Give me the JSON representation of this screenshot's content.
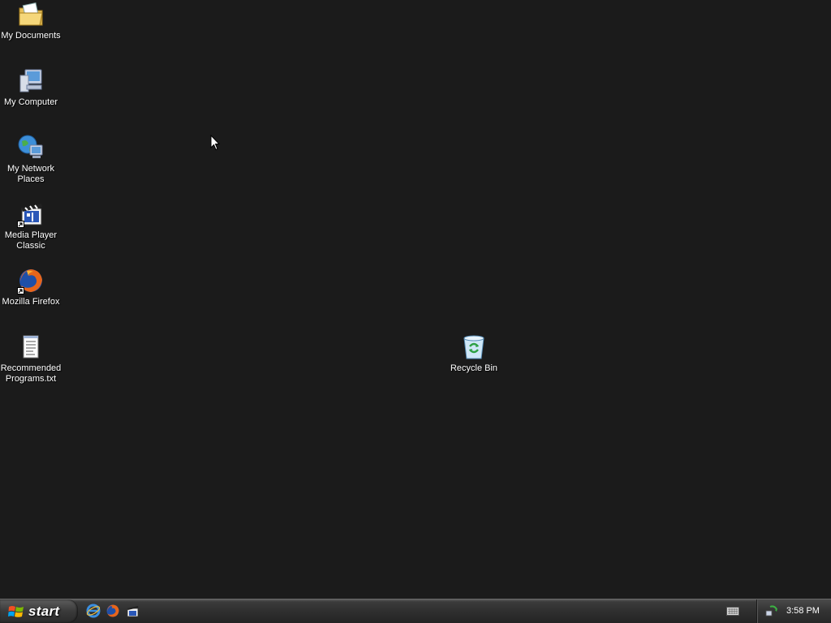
{
  "desktop": {
    "icons": [
      {
        "label": "My Documents",
        "icon": "folder-documents-icon"
      },
      {
        "label": "My Computer",
        "icon": "computer-icon"
      },
      {
        "label": "My Network Places",
        "icon": "network-places-icon"
      },
      {
        "label": "Media Player Classic",
        "icon": "media-player-classic-icon"
      },
      {
        "label": "Mozilla Firefox",
        "icon": "firefox-icon"
      },
      {
        "label": "Recommended Programs.txt",
        "icon": "text-file-icon"
      }
    ],
    "recycle_bin": {
      "label": "Recycle Bin",
      "icon": "recycle-bin-icon"
    }
  },
  "taskbar": {
    "start_label": "start",
    "quick_launch": [
      "internet-explorer-icon",
      "firefox-icon",
      "media-player-classic-icon"
    ],
    "tray": {
      "keyboard_icon": "keyboard-icon",
      "network_icon": "network-status-icon",
      "clock": "3:58 PM"
    }
  },
  "colors": {
    "desktop_background": "#1b1b1b",
    "taskbar": "#2e2e2e",
    "label_text": "#ffffff"
  }
}
